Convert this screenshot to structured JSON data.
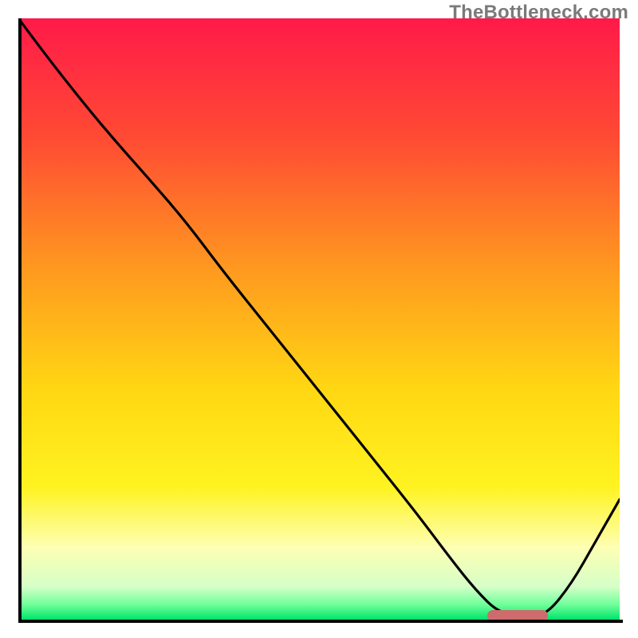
{
  "watermark": "TheBottleneck.com",
  "chart_data": {
    "type": "line",
    "title": "",
    "xlabel": "",
    "ylabel": "",
    "xlim": [
      0,
      100
    ],
    "ylim": [
      0,
      100
    ],
    "gradient_stops": [
      {
        "offset": 0,
        "color": "#ff1a49"
      },
      {
        "offset": 0.2,
        "color": "#ff4b33"
      },
      {
        "offset": 0.42,
        "color": "#ff9a1f"
      },
      {
        "offset": 0.62,
        "color": "#ffd813"
      },
      {
        "offset": 0.78,
        "color": "#fff321"
      },
      {
        "offset": 0.88,
        "color": "#fdffb3"
      },
      {
        "offset": 0.945,
        "color": "#d6ffc8"
      },
      {
        "offset": 0.975,
        "color": "#6fff9a"
      },
      {
        "offset": 1.0,
        "color": "#00e36b"
      }
    ],
    "series": [
      {
        "name": "curve",
        "x": [
          0,
          6,
          14,
          22,
          28,
          34,
          42,
          50,
          58,
          66,
          72,
          76,
          80,
          85,
          88,
          92,
          96,
          100
        ],
        "y": [
          100,
          92,
          82,
          73,
          66,
          58,
          48,
          38,
          28,
          18,
          10,
          5,
          1,
          0.5,
          1,
          6,
          13,
          20
        ]
      }
    ],
    "marker": {
      "x_start": 78,
      "x_end": 88,
      "y": 0,
      "color": "#cd6b6d"
    },
    "axes": {
      "show_ticks": false,
      "show_grid": false
    }
  }
}
